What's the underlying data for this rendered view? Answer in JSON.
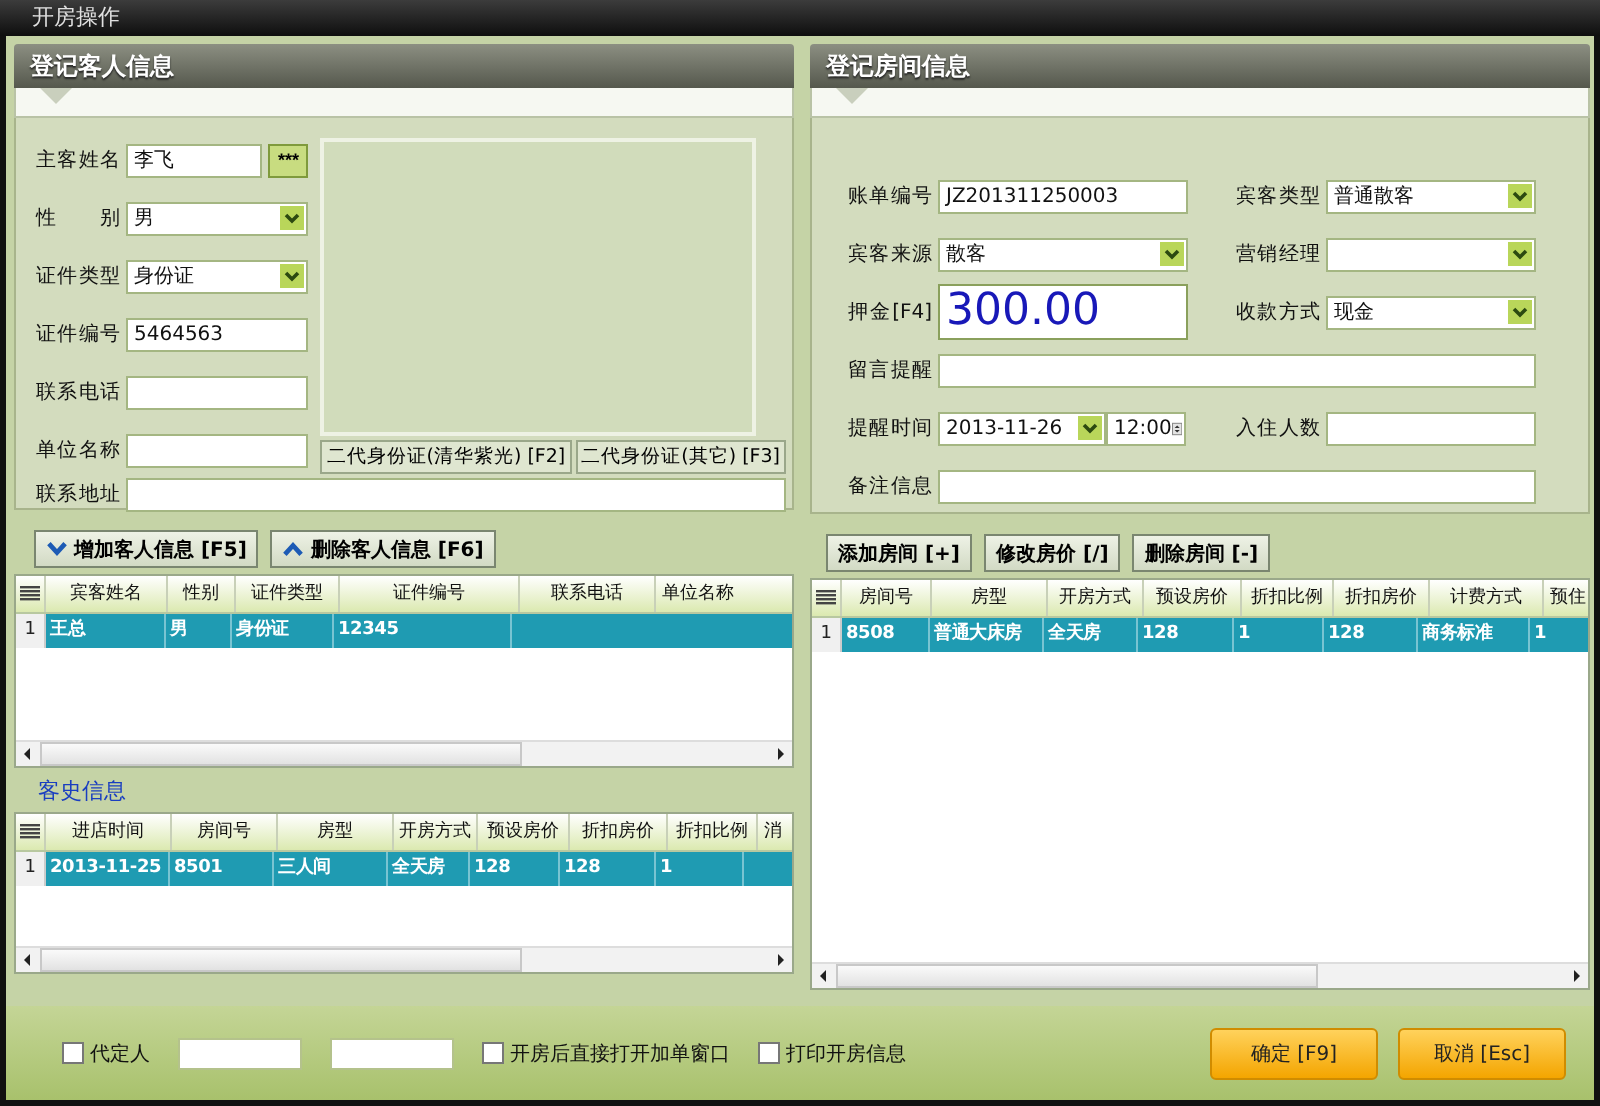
{
  "window": {
    "title": "开房操作"
  },
  "guest_panel": {
    "title": "登记客人信息",
    "fields": [
      {
        "label": "主客姓名",
        "kind": "text_button",
        "value": "李飞",
        "button": "***"
      },
      {
        "label": "性 别",
        "kind": "select",
        "value": "男"
      },
      {
        "label": "证件类型",
        "kind": "select",
        "value": "身份证"
      },
      {
        "label": "证件编号",
        "kind": "text",
        "value": "5464563"
      },
      {
        "label": "联系电话",
        "kind": "text"
      },
      {
        "label": "单位名称",
        "kind": "text"
      },
      {
        "label": "联系地址",
        "kind": "long_text"
      }
    ],
    "id_card_buttons": [
      "二代身份证(清华紫光) [F2]",
      "二代身份证(其它) [F3]"
    ],
    "actions": [
      {
        "label": "增加客人信息 [F5]",
        "kind": "add"
      },
      {
        "label": "删除客人信息 [F6]",
        "kind": "remove"
      }
    ],
    "table": {
      "columns": [
        "宾客姓名",
        "性别",
        "证件类型",
        "证件编号",
        "联系电话",
        "单位名称"
      ],
      "rows": [
        {
          "number": "1",
          "selected": true,
          "cells": [
            "王总",
            "男",
            "身份证",
            "12345"
          ]
        }
      ]
    },
    "history": {
      "title": "客史信息",
      "table": {
        "columns": [
          "进店时间",
          "房间号",
          "房型",
          "开房方式",
          "预设房价",
          "折扣房价",
          "折扣比例",
          "消"
        ],
        "rows": [
          {
            "number": "1",
            "selected": true,
            "cells": [
              "2013-11-25",
              "8501",
              "三人间",
              "全天房",
              "128",
              "128",
              "1"
            ]
          }
        ]
      }
    }
  },
  "room_panel": {
    "title": "登记房间信息",
    "fields": [
      {
        "label": "账单编号",
        "kind": "text",
        "value": "JZ201311250003"
      },
      {
        "label": "宾客类型",
        "kind": "select",
        "value": "普通散客"
      },
      {
        "label": "宾客来源",
        "kind": "select",
        "value": "散客"
      },
      {
        "label": "营销经理",
        "kind": "select"
      },
      {
        "label": "押金[F4]",
        "kind": "money",
        "value": "300.00"
      },
      {
        "label": "收款方式",
        "kind": "select",
        "value": "现金"
      },
      {
        "label": "留言提醒",
        "kind": "long_text"
      },
      {
        "label": "提醒时间",
        "kind": "datetime",
        "value": "2013-11-26",
        "time": "12:00"
      },
      {
        "label": "入住人数",
        "kind": "text"
      },
      {
        "label": "备注信息",
        "kind": "long_text"
      }
    ],
    "actions": [
      "添加房间 [+]",
      "修改房价 [/]",
      "删除房间 [-]"
    ],
    "table": {
      "columns": [
        "房间号",
        "房型",
        "开房方式",
        "预设房价",
        "折扣比例",
        "折扣房价",
        "计费方式",
        "预住"
      ],
      "rows": [
        {
          "number": "1",
          "selected": true,
          "cells": [
            "8508",
            "普通大床房",
            "全天房",
            "128",
            "1",
            "128",
            "商务标准",
            "1"
          ]
        }
      ]
    }
  },
  "footer": {
    "options": [
      {
        "kind": "checkbox",
        "label": "代定人",
        "checked": false
      },
      {
        "kind": "field"
      },
      {
        "kind": "field"
      },
      {
        "kind": "checkbox",
        "label": "开房后直接打开加单窗口",
        "checked": false
      },
      {
        "kind": "checkbox",
        "label": "打印开房信息",
        "checked": false
      }
    ],
    "buttons": [
      "确定 [F9]",
      "取消 [Esc]"
    ]
  }
}
